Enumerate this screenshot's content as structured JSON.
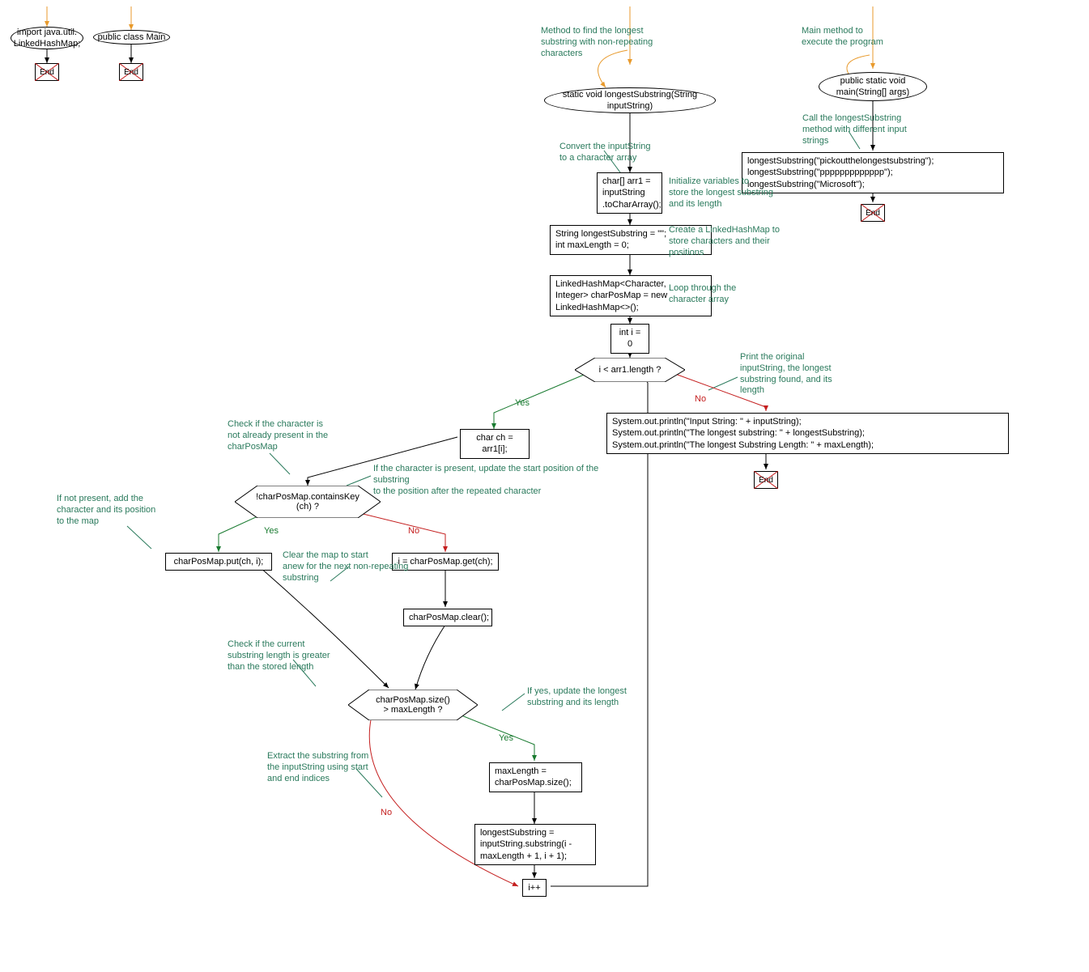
{
  "nodes": {
    "import": "import java.util.\nLinkedHashMap;",
    "class": "public class Main",
    "end": "End",
    "method_sig": "static void longestSubstring(String\ninputString)",
    "main_sig": "public static void\nmain(String[] args)",
    "char_arr": "char[] arr1 =\ninputString\n.toCharArray();",
    "init_vars": "String longestSubstring = \"\";\nint maxLength = 0;",
    "linked_map": "LinkedHashMap<Character,\nInteger> charPosMap = new\nLinkedHashMap<>();",
    "init_i": "int i = 0",
    "loop_cond": "i < arr1.length ?",
    "char_ch": "char ch = arr1[i];",
    "contains_cond": "!charPosMap.containsKey\n(ch) ?",
    "put": "charPosMap.put(ch, i);",
    "get": "i = charPosMap.get(ch);",
    "clear": "charPosMap.clear();",
    "size_cond": "charPosMap.size()\n> maxLength ?",
    "maxlen": "maxLength =\ncharPosMap.size();",
    "substring": "longestSubstring =\ninputString.substring(i -\nmaxLength + 1, i + 1);",
    "inc": "i++",
    "print": "System.out.println(\"Input String: \" + inputString);\nSystem.out.println(\"The longest substring: \" + longestSubstring);\nSystem.out.println(\"The longest Substring Length: \" + maxLength);",
    "main_calls": "longestSubstring(\"pickoutthelongestsubstring\");\nlongestSubstring(\"ppppppppppppp\");\nlongestSubstring(\"Microsoft\");"
  },
  "annotations": {
    "method_find": "Method to find the longest\nsubstring with non-repeating\ncharacters",
    "main_exec": "Main method to\nexecute the program",
    "convert": "Convert the inputString\nto a character array",
    "init_store": "Initialize variables to\nstore the longest substring\nand its length",
    "create_map": "Create a LinkedHashMap to\nstore characters and their\npositions",
    "loop_arr": "Loop through the\ncharacter array",
    "check_not_present": "Check if the character is\nnot already present in the\ncharPosMap",
    "if_not_present": "If not present, add the\ncharacter and its position\nto the map",
    "if_present": "If the character is present, update the start position of the\nsubstring\nto the position after the repeated character",
    "clear_map": "Clear the map to start\nanew for the next non-repeating\nsubstring",
    "check_len": "Check if the current\nsubstring length is greater\nthan the stored length",
    "if_yes_update": "If yes, update the longest\nsubstring and its length",
    "extract": "Extract the substring from\nthe inputString using start\nand end indices",
    "print_orig": "Print the original\ninputString, the longest\nsubstring found, and its\nlength",
    "call_with": "Call the longestSubstring\nmethod with different input\nstrings"
  },
  "labels": {
    "yes": "Yes",
    "no": "No"
  }
}
